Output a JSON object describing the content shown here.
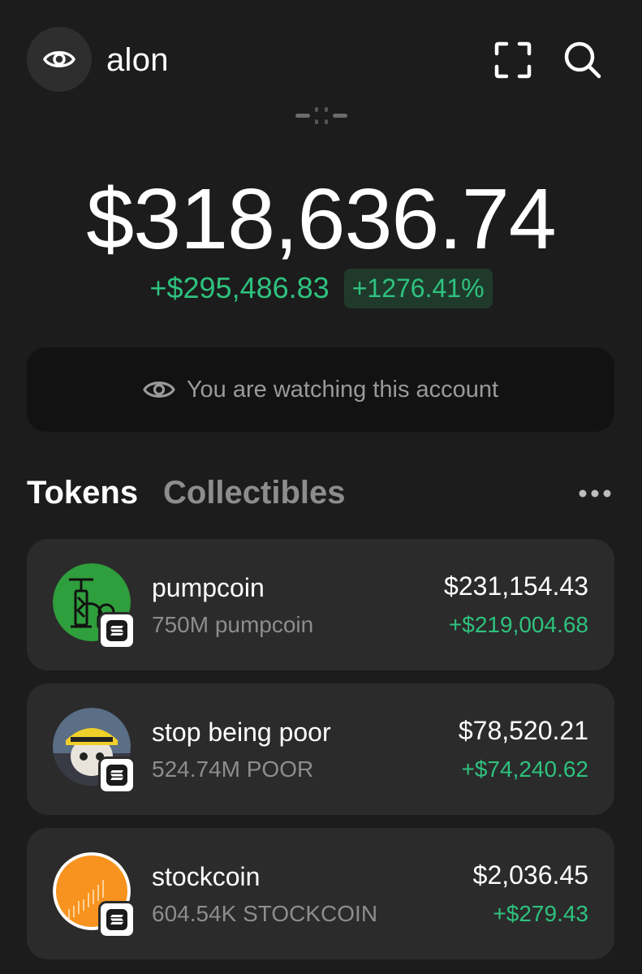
{
  "header": {
    "account_name": "alon",
    "eye_icon": "eye-icon",
    "scan_icon": "scan-icon",
    "search_icon": "search-icon"
  },
  "portfolio": {
    "balance": "$318,636.74",
    "change_amount": "+$295,486.83",
    "change_percent": "+1276.41%"
  },
  "watch_banner": {
    "text": "You are watching this account",
    "icon": "eye-icon"
  },
  "tabs": {
    "tokens": "Tokens",
    "collectibles": "Collectibles",
    "active": "tokens",
    "more_icon": "ellipsis-icon"
  },
  "colors": {
    "background": "#1c1c1c",
    "card": "#2b2b2b",
    "positive": "#2ec27e"
  },
  "tokens": [
    {
      "name": "pumpcoin",
      "amount": "750M pumpcoin",
      "value": "$231,154.43",
      "change": "+$219,004.68",
      "logo": "pump-logo",
      "chain_icon": "solana-icon"
    },
    {
      "name": "stop being poor",
      "amount": "524.74M POOR",
      "value": "$78,520.21",
      "change": "+$74,240.62",
      "logo": "poor-logo",
      "chain_icon": "solana-icon"
    },
    {
      "name": "stockcoin",
      "amount": "604.54K STOCKCOIN",
      "value": "$2,036.45",
      "change": "+$279.43",
      "logo": "stockcoin-logo",
      "chain_icon": "solana-icon"
    }
  ]
}
